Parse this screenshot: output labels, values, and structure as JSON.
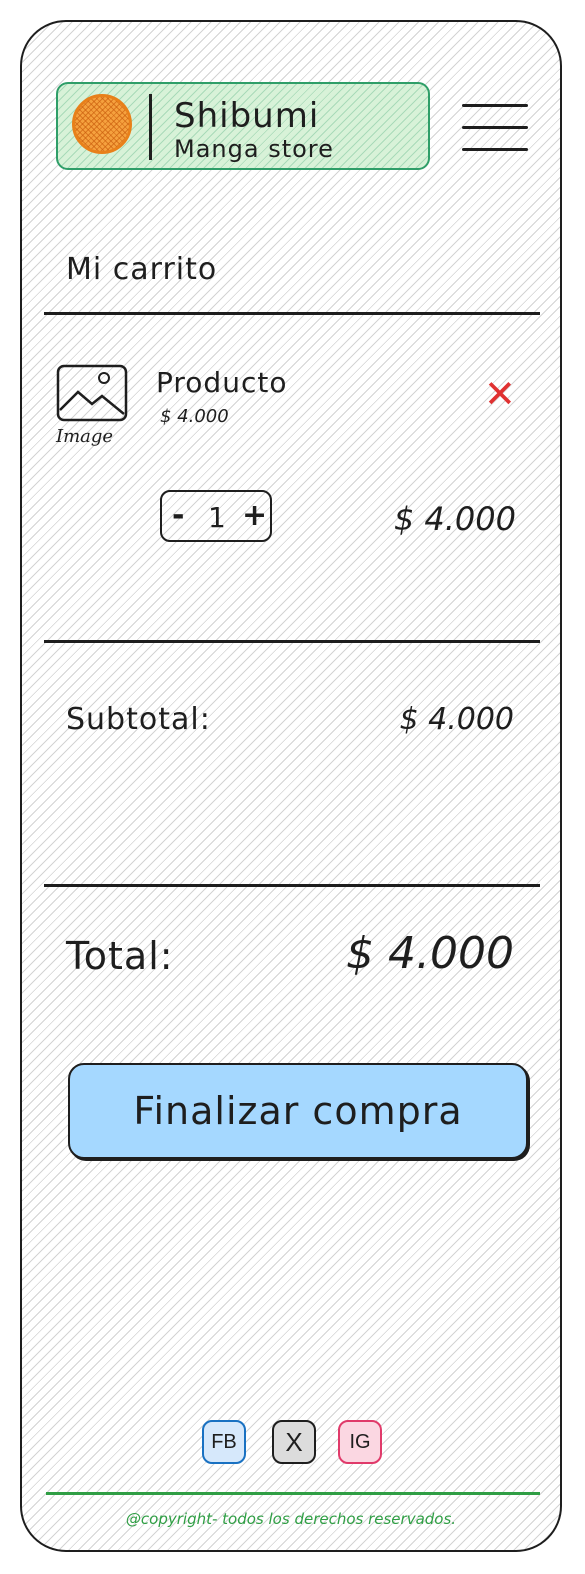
{
  "brand": {
    "name": "Shibumi",
    "subtitle": "Manga store"
  },
  "page": {
    "title": "Mi carrito"
  },
  "cart": {
    "items": [
      {
        "image_caption": "Image",
        "name": "Producto",
        "unit_price": "$ 4.000",
        "quantity": "1",
        "decrement": "-",
        "increment": "+",
        "remove": "✕",
        "line_total": "$ 4.000"
      }
    ]
  },
  "summary": {
    "subtotal_label": "Subtotal:",
    "subtotal_value": "$ 4.000",
    "total_label": "Total:",
    "total_value": "$ 4.000"
  },
  "actions": {
    "checkout_label": "Finalizar compra"
  },
  "social": {
    "facebook": "FB",
    "x": "X",
    "instagram": "IG"
  },
  "footer": {
    "copyright": "@copyright- todos los derechos reservados."
  },
  "colors": {
    "brand_border": "#2f9e68",
    "logo_orange": "#f08c00",
    "remove": "#e03131",
    "checkout_bg": "#a5d8ff",
    "footer": "#2f9e44"
  }
}
